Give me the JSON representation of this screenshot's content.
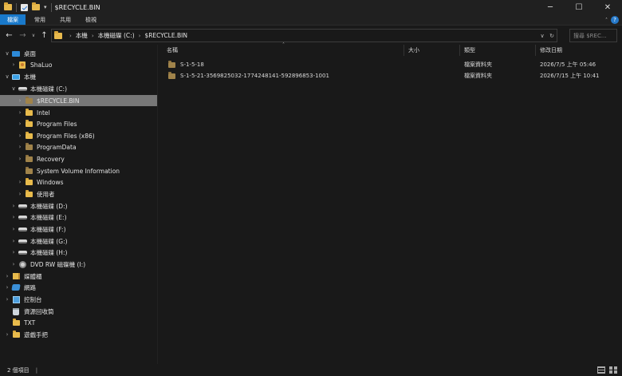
{
  "window": {
    "title": "$RECYCLE.BIN",
    "minimize": "─",
    "maximize": "☐",
    "close": "✕"
  },
  "quick_access": {
    "dropdown": "▾"
  },
  "ribbon": {
    "tabs": [
      "檔案",
      "常用",
      "共用",
      "檢視"
    ],
    "collapse": "˄",
    "help": "?"
  },
  "nav": {
    "back": "←",
    "forward": "→",
    "recent": "∨",
    "up": "↑",
    "breadcrumb": [
      "本機",
      "本機磁碟 (C:)",
      "$RECYCLE.BIN"
    ],
    "addr_dropdown": "∨",
    "refresh": "↻",
    "search_placeholder": "搜尋 $REC...",
    "search_icon": "⌕"
  },
  "tree": [
    {
      "label": "桌面",
      "icon": "desktop-icon",
      "expander": "∨"
    },
    {
      "label": "ShaLuo",
      "icon": "user-folder-icon",
      "expander": "›"
    },
    {
      "label": "本機",
      "icon": "pc-icon",
      "expander": "∨"
    },
    {
      "label": "本機磁碟 (C:)",
      "icon": "drive-icon",
      "expander": "∨"
    },
    {
      "label": "$RECYCLE.BIN",
      "icon": "folder-dim-icon",
      "expander": "›",
      "selected": true
    },
    {
      "label": "Intel",
      "icon": "folder-icon",
      "expander": "›"
    },
    {
      "label": "Program Files",
      "icon": "folder-icon",
      "expander": "›"
    },
    {
      "label": "Program Files (x86)",
      "icon": "folder-icon",
      "expander": "›"
    },
    {
      "label": "ProgramData",
      "icon": "folder-dim-icon",
      "expander": "›"
    },
    {
      "label": "Recovery",
      "icon": "folder-dim-icon",
      "expander": "›"
    },
    {
      "label": "System Volume Information",
      "icon": "folder-dim-icon",
      "expander": ""
    },
    {
      "label": "Windows",
      "icon": "folder-icon",
      "expander": "›"
    },
    {
      "label": "使用者",
      "icon": "folder-icon",
      "expander": "›"
    },
    {
      "label": "本機磁碟 (D:)",
      "icon": "drive-icon",
      "expander": "›"
    },
    {
      "label": "本機磁碟 (E:)",
      "icon": "drive-icon",
      "expander": "›"
    },
    {
      "label": "本機磁碟 (F:)",
      "icon": "drive-icon",
      "expander": "›"
    },
    {
      "label": "本機磁碟 (G:)",
      "icon": "drive-icon",
      "expander": "›"
    },
    {
      "label": "本機磁碟 (H:)",
      "icon": "drive-icon",
      "expander": "›"
    },
    {
      "label": "DVD RW 磁碟機 (I:)",
      "icon": "dvd-icon",
      "expander": "›"
    },
    {
      "label": "媒體櫃",
      "icon": "library-icon",
      "expander": "›"
    },
    {
      "label": "網路",
      "icon": "network-icon",
      "expander": "›"
    },
    {
      "label": "控制台",
      "icon": "control-panel-icon",
      "expander": "›"
    },
    {
      "label": "資源回收筒",
      "icon": "recycle-bin-icon",
      "expander": ""
    },
    {
      "label": "TXT",
      "icon": "folder-icon",
      "expander": ""
    },
    {
      "label": "遊戲手把",
      "icon": "folder-icon",
      "expander": "›"
    }
  ],
  "columns": {
    "name": "名稱",
    "size": "大小",
    "type": "類型",
    "modified": "修改日期",
    "sort_indicator": "˄"
  },
  "files": [
    {
      "name": "S-1-5-18",
      "size": "",
      "type": "檔案資料夾",
      "modified": "2026/7/5 上午 05:46"
    },
    {
      "name": "S-1-5-21-3569825032-1774248141-592896853-1001",
      "size": "",
      "type": "檔案資料夾",
      "modified": "2026/7/15 上午 10:41"
    }
  ],
  "status": {
    "item_count": "2 個項目",
    "separator": "|"
  }
}
